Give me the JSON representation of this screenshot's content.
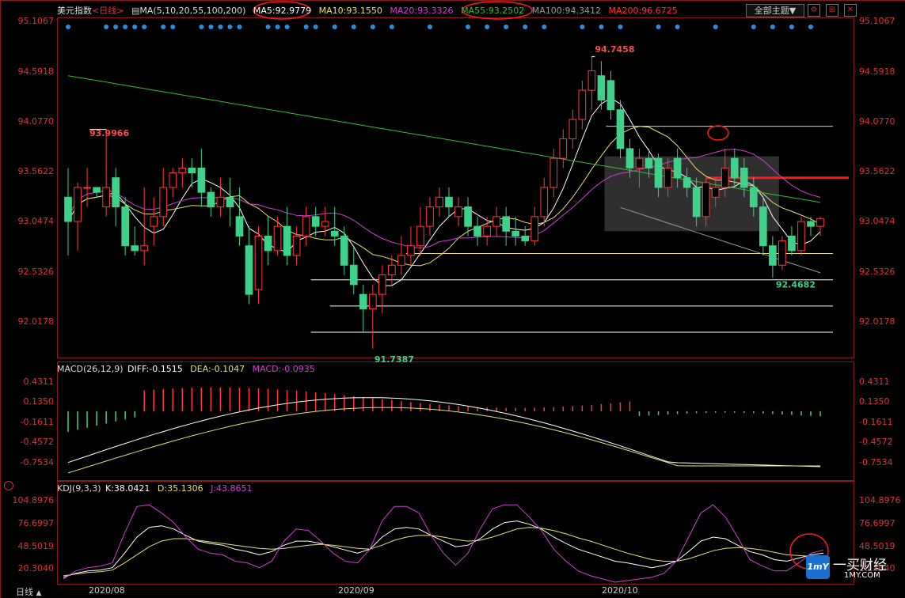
{
  "header": {
    "symbol": "美元指数",
    "period": "<日线>",
    "ma_params": "MA(5,10,20,55,100,200)",
    "ma5": "MA5:92.9779",
    "ma10": "MA10:93.1550",
    "ma20": "MA20:93.3326",
    "ma55": "MA55:93.2502",
    "ma100": "MA100:94.3412",
    "ma200": "MA200:96.6725",
    "theme_button": "全部主题▼",
    "colors": {
      "ma5": "#ffffff",
      "ma10": "#e8e070",
      "ma20": "#d040d0",
      "ma55": "#30c030",
      "ma100": "#a0a0a0",
      "ma200": "#ff3030"
    }
  },
  "macd_header": {
    "params": "MACD(26,12,9)",
    "diff": "DIFF:-0.1515",
    "dea": "DEA:-0.1047",
    "macd": "MACD:-0.0935"
  },
  "kdj_header": {
    "params": "KDJ(9,3,3)",
    "k": "K:38.0421",
    "d": "D:35.1306",
    "j": "J:43.8651"
  },
  "bottom": {
    "tab": "日线",
    "tab_icon": "triangle-up-icon"
  },
  "logo": {
    "text": "一买财经",
    "url": "1MY.COM",
    "badge": "1mY"
  },
  "chart_data": [
    {
      "type": "candlestick",
      "title": "美元指数",
      "y_ticks": [
        "95.1067",
        "94.5918",
        "94.0770",
        "93.5622",
        "93.0474",
        "92.5326",
        "92.0178"
      ],
      "ylim": [
        91.65,
        95.15
      ],
      "x_ticks": [
        "2020/08",
        "2020/09",
        "2020/10"
      ],
      "annotations": {
        "high_labels": [
          "93.9966",
          "94.7458"
        ],
        "low_labels": [
          "91.7387",
          "92.4682"
        ]
      },
      "candles": [
        [
          93.3,
          93.6,
          92.7,
          93.05
        ],
        [
          93.05,
          93.45,
          92.75,
          93.4
        ],
        [
          93.4,
          93.6,
          93.2,
          93.4
        ],
        [
          93.4,
          93.4,
          93.3,
          93.35
        ],
        [
          93.2,
          94.0,
          93.1,
          93.4
        ],
        [
          93.5,
          93.6,
          93.0,
          93.2
        ],
        [
          93.2,
          93.3,
          92.7,
          92.8
        ],
        [
          92.8,
          93.0,
          92.7,
          92.75
        ],
        [
          92.75,
          93.4,
          92.6,
          92.8
        ],
        [
          93.0,
          93.3,
          92.8,
          93.1
        ],
        [
          93.1,
          93.6,
          93.0,
          93.4
        ],
        [
          93.4,
          93.6,
          93.3,
          93.55
        ],
        [
          93.55,
          93.7,
          93.4,
          93.6
        ],
        [
          93.6,
          93.7,
          93.4,
          93.55
        ],
        [
          93.6,
          93.8,
          93.2,
          93.35
        ],
        [
          93.35,
          93.4,
          93.1,
          93.2
        ],
        [
          93.2,
          93.5,
          93.1,
          93.3
        ],
        [
          93.3,
          93.5,
          93.0,
          93.2
        ],
        [
          93.1,
          93.4,
          92.8,
          92.9
        ],
        [
          92.8,
          93.0,
          92.2,
          92.3
        ],
        [
          92.35,
          93.0,
          92.2,
          92.9
        ],
        [
          92.9,
          93.1,
          92.6,
          92.75
        ],
        [
          92.75,
          93.1,
          92.7,
          93.0
        ],
        [
          93.0,
          93.2,
          92.6,
          92.7
        ],
        [
          92.7,
          93.0,
          92.6,
          92.9
        ],
        [
          92.9,
          93.2,
          92.8,
          93.1
        ],
        [
          93.1,
          93.2,
          92.9,
          93.0
        ],
        [
          93.0,
          93.2,
          92.9,
          93.05
        ],
        [
          92.95,
          93.2,
          92.8,
          92.9
        ],
        [
          92.9,
          93.0,
          92.5,
          92.6
        ],
        [
          92.6,
          92.8,
          92.3,
          92.4
        ],
        [
          92.3,
          92.4,
          91.9,
          92.15
        ],
        [
          92.15,
          92.4,
          91.74,
          92.3
        ],
        [
          92.3,
          92.6,
          92.1,
          92.5
        ],
        [
          92.5,
          92.7,
          92.4,
          92.6
        ],
        [
          92.6,
          92.9,
          92.5,
          92.7
        ],
        [
          92.7,
          93.0,
          92.6,
          92.8
        ],
        [
          92.8,
          93.2,
          92.7,
          93.0
        ],
        [
          93.0,
          93.3,
          92.9,
          93.2
        ],
        [
          93.2,
          93.4,
          93.1,
          93.3
        ],
        [
          93.3,
          93.4,
          93.1,
          93.2
        ],
        [
          93.1,
          93.3,
          93.0,
          93.2
        ],
        [
          93.2,
          93.3,
          92.9,
          93.0
        ],
        [
          93.0,
          93.1,
          92.8,
          92.9
        ],
        [
          92.9,
          93.1,
          92.8,
          93.0
        ],
        [
          93.0,
          93.2,
          92.9,
          93.1
        ],
        [
          93.1,
          93.2,
          92.8,
          92.95
        ],
        [
          92.95,
          93.1,
          92.8,
          92.9
        ],
        [
          92.9,
          93.0,
          92.8,
          92.85
        ],
        [
          92.85,
          93.2,
          92.8,
          93.1
        ],
        [
          93.1,
          93.5,
          93.0,
          93.4
        ],
        [
          93.4,
          93.8,
          93.3,
          93.7
        ],
        [
          93.7,
          94.0,
          93.6,
          93.9
        ],
        [
          93.9,
          94.2,
          93.8,
          94.1
        ],
        [
          94.1,
          94.5,
          94.0,
          94.4
        ],
        [
          94.4,
          94.75,
          94.2,
          94.6
        ],
        [
          94.55,
          94.7,
          94.2,
          94.3
        ],
        [
          94.5,
          94.6,
          94.1,
          94.2
        ],
        [
          94.2,
          94.3,
          93.7,
          93.8
        ],
        [
          93.8,
          93.9,
          93.5,
          93.6
        ],
        [
          93.6,
          93.8,
          93.4,
          93.7
        ],
        [
          93.7,
          93.8,
          93.5,
          93.6
        ],
        [
          93.7,
          93.75,
          93.3,
          93.4
        ],
        [
          93.4,
          93.7,
          93.3,
          93.6
        ],
        [
          93.7,
          93.8,
          93.4,
          93.5
        ],
        [
          93.5,
          93.6,
          93.3,
          93.4
        ],
        [
          93.4,
          93.5,
          93.0,
          93.1
        ],
        [
          93.1,
          93.5,
          93.0,
          93.45
        ],
        [
          93.3,
          93.5,
          93.2,
          93.4
        ],
        [
          93.4,
          93.8,
          93.3,
          93.6
        ],
        [
          93.7,
          93.8,
          93.4,
          93.5
        ],
        [
          93.6,
          93.7,
          93.3,
          93.4
        ],
        [
          93.4,
          93.5,
          93.1,
          93.2
        ],
        [
          93.2,
          93.3,
          92.7,
          92.8
        ],
        [
          92.8,
          92.9,
          92.47,
          92.6
        ],
        [
          92.6,
          92.9,
          92.55,
          92.85
        ],
        [
          92.9,
          93.0,
          92.7,
          92.75
        ],
        [
          92.75,
          93.1,
          92.7,
          93.05
        ],
        [
          93.05,
          93.1,
          92.9,
          93.0
        ],
        [
          93.0,
          93.1,
          92.9,
          93.08
        ]
      ]
    },
    {
      "type": "bar",
      "title": "MACD(26,12,9)",
      "y_ticks": [
        "0.4311",
        "0.1350",
        "-0.1611",
        "-0.4572",
        "-0.7534"
      ],
      "ylim": [
        -0.95,
        0.52
      ]
    },
    {
      "type": "line",
      "title": "KDJ(9,3,3)",
      "y_ticks": [
        "104.8976",
        "76.6997",
        "48.5019",
        "20.3040"
      ],
      "ylim": [
        5,
        112
      ],
      "series": [
        {
          "name": "K",
          "values": [
            10,
            15,
            18,
            19,
            22,
            40,
            60,
            72,
            74,
            70,
            62,
            55,
            52,
            50,
            45,
            42,
            38,
            42,
            50,
            55,
            55,
            52,
            48,
            44,
            40,
            45,
            60,
            70,
            72,
            70,
            62,
            55,
            48,
            50,
            58,
            70,
            78,
            80,
            76,
            70,
            60,
            52,
            45,
            40,
            35,
            30,
            28,
            25,
            22,
            25,
            30,
            42,
            55,
            60,
            58,
            50,
            42,
            38,
            32,
            30,
            34,
            38,
            40
          ]
        },
        {
          "name": "D",
          "values": [
            12,
            14,
            16,
            17,
            19,
            28,
            38,
            48,
            55,
            58,
            58,
            56,
            54,
            52,
            50,
            48,
            46,
            45,
            46,
            48,
            50,
            51,
            50,
            48,
            46,
            45,
            50,
            56,
            60,
            62,
            62,
            60,
            57,
            55,
            56,
            60,
            65,
            70,
            72,
            71,
            68,
            64,
            59,
            55,
            50,
            45,
            40,
            36,
            32,
            30,
            30,
            33,
            38,
            43,
            46,
            47,
            46,
            44,
            41,
            38,
            37,
            36,
            35
          ]
        },
        {
          "name": "J",
          "values": [
            8,
            18,
            22,
            24,
            28,
            65,
            98,
            100,
            90,
            78,
            60,
            45,
            40,
            38,
            30,
            28,
            22,
            30,
            55,
            70,
            68,
            55,
            40,
            30,
            28,
            45,
            80,
            98,
            98,
            90,
            62,
            40,
            25,
            40,
            70,
            95,
            100,
            100,
            85,
            68,
            45,
            30,
            18,
            12,
            8,
            4,
            6,
            8,
            10,
            15,
            30,
            60,
            90,
            100,
            85,
            60,
            32,
            24,
            18,
            18,
            28,
            40,
            44
          ]
        }
      ]
    }
  ]
}
